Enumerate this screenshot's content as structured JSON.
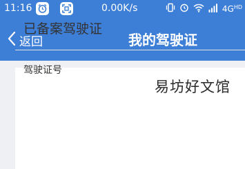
{
  "status_bar": {
    "time": "11:16",
    "net_speed": "0.00K/s",
    "network_label": "4G",
    "network_sub": "HD",
    "app_icons": [
      "alarm-app-icon",
      "scan-app-icon"
    ],
    "system_icons": [
      "vibrate-icon",
      "alarm-clock-icon",
      "wifi-icon",
      "signal-icon"
    ]
  },
  "nav": {
    "back_label": "返回",
    "title": "我的驾驶证"
  },
  "card": {
    "section_title": "已备案驾驶证",
    "field_label": "驾驶证号"
  },
  "watermark": {
    "text": "易坊好文馆"
  },
  "colors": {
    "header_bg": "#3d7ed6",
    "content_bg": "#eef0f3",
    "card_bg": "#ffffff",
    "text_dark": "#333333"
  }
}
